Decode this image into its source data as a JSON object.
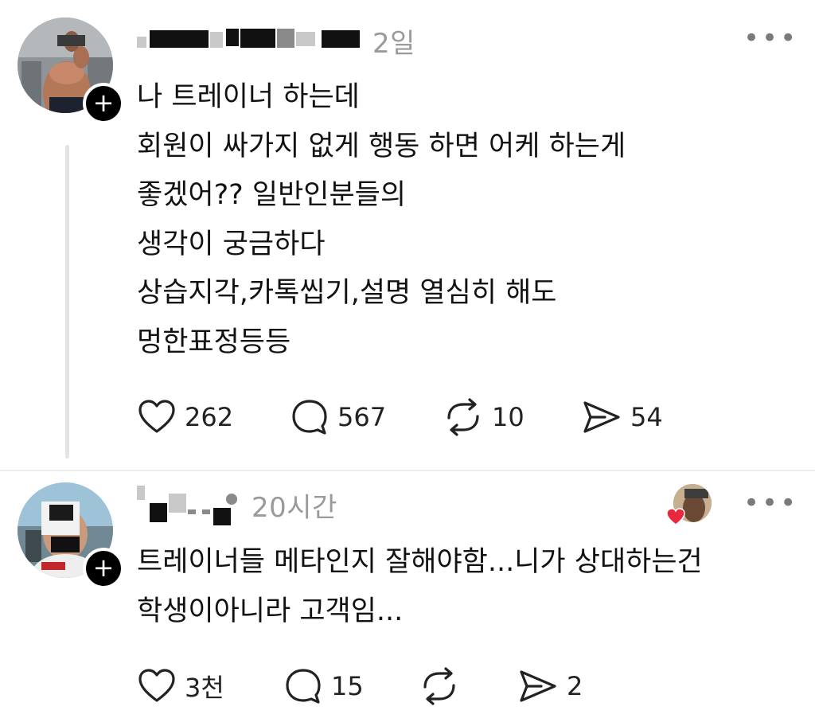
{
  "posts": [
    {
      "time": "2일",
      "more": "•••",
      "lines": [
        "나 트레이너 하는데",
        "회원이 싸가지 없게 행동 하면 어케 하는게",
        "좋겠어?? 일반인분들의",
        "생각이 궁금하다",
        "상습지각,카톡씹기,설명 열심히 해도",
        "멍한표정등등"
      ],
      "actions": {
        "likes": "262",
        "replies": "567",
        "reposts": "10",
        "shares": "54"
      }
    },
    {
      "time": "20시간",
      "more": "•••",
      "lines": [
        "트레이너들 메타인지 잘해야함...니가 상대하는건",
        "학생이아니라 고객임..."
      ],
      "actions": {
        "likes": "3천",
        "replies": "15",
        "reposts": "",
        "shares": "2"
      }
    }
  ],
  "follow_symbol": "+",
  "colors": {
    "text": "#121212",
    "muted": "#9a9a9a",
    "heart_badge": "#e8283c"
  }
}
